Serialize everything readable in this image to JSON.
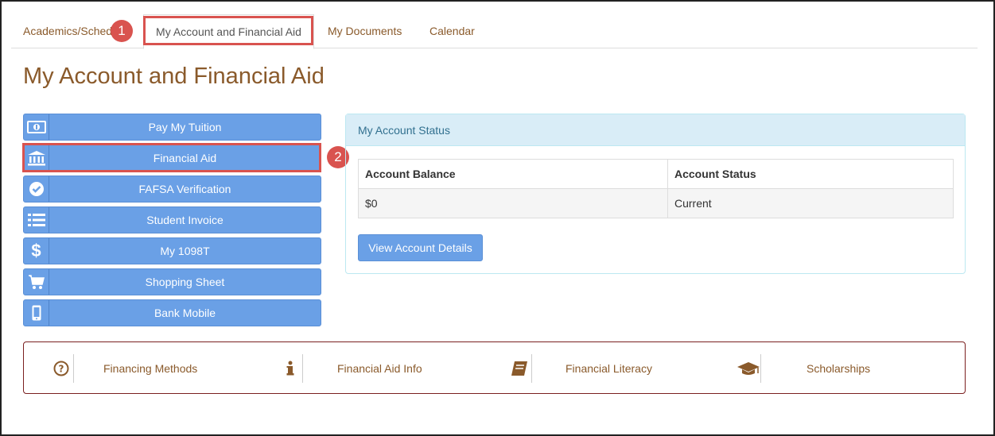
{
  "tabs": [
    {
      "label": "Academics/Sched"
    },
    {
      "label": "My Account and Financial Aid"
    },
    {
      "label": "My Documents"
    },
    {
      "label": "Calendar"
    }
  ],
  "callouts": [
    "1",
    "2"
  ],
  "page_title": "My Account and Financial Aid",
  "menu": [
    {
      "label": "Pay My Tuition",
      "icon": "money-icon"
    },
    {
      "label": "Financial Aid",
      "icon": "bank-icon"
    },
    {
      "label": "FAFSA Verification",
      "icon": "check-circle-icon"
    },
    {
      "label": "Student Invoice",
      "icon": "list-icon"
    },
    {
      "label": "My 1098T",
      "icon": "dollar-icon"
    },
    {
      "label": "Shopping Sheet",
      "icon": "cart-icon"
    },
    {
      "label": "Bank Mobile",
      "icon": "mobile-icon"
    }
  ],
  "account_status": {
    "heading": "My Account Status",
    "columns": [
      "Account Balance",
      "Account Status"
    ],
    "rows": [
      [
        "$0",
        "Current"
      ]
    ],
    "button": "View Account Details"
  },
  "links": [
    {
      "label": "Financing Methods",
      "icon": "question-circle-icon"
    },
    {
      "label": "Financial Aid Info",
      "icon": "info-icon"
    },
    {
      "label": "Financial Literacy",
      "icon": "book-icon"
    },
    {
      "label": "Scholarships",
      "icon": "graduation-cap-icon"
    }
  ],
  "colors": {
    "accent": "#6aa0e6",
    "brand": "#8a5a2b",
    "highlight": "#d9534f",
    "panel_head": "#d9edf7"
  }
}
